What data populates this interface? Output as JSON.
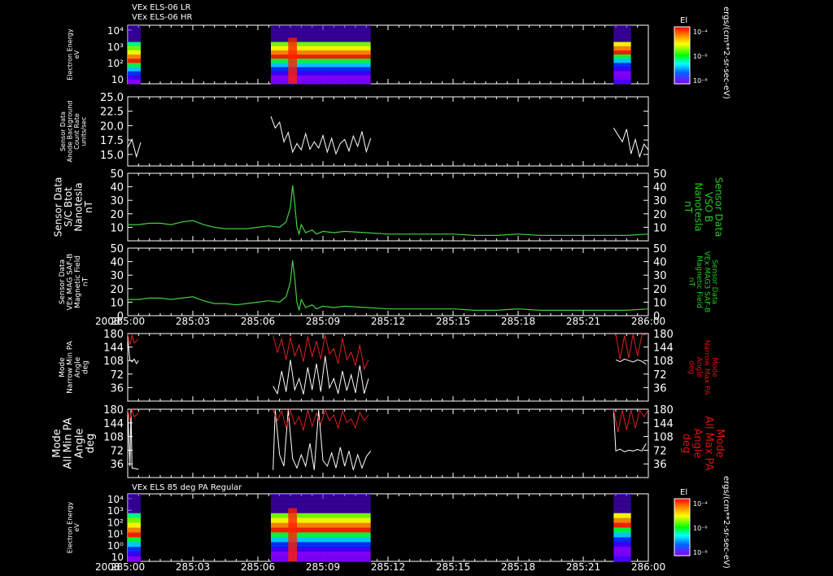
{
  "titles": {
    "top_line1": "VEx ELS-06 LR",
    "top_line2": "VEx ELS-06 HR",
    "bottom": "VEx ELS 85 deg PA Regular"
  },
  "year_label": "2008",
  "time_ticks": [
    "285:00",
    "285:03",
    "285:06",
    "285:09",
    "285:12",
    "285:15",
    "285:18",
    "285:21",
    "286:00"
  ],
  "colorbar": {
    "label": "El",
    "units": "ergs/(cm**2-sr-sec-eV)",
    "tick_labels": [
      "10⁻⁴",
      "10⁻⁶",
      "10⁻⁸"
    ]
  },
  "colors": {
    "trace": "#40d040",
    "min_pa": "#ffffff",
    "max_pa": "#e02020",
    "right_label": "#22c822",
    "right_label_red": "#dd1111"
  },
  "chart_data": [
    {
      "type": "heatmap",
      "panel": "electron-energy-top",
      "ylabel": [
        "Electron Energy",
        "eV"
      ],
      "y_tick_labels": [
        "10⁴",
        "10³",
        "10²",
        "10"
      ],
      "y_scale": "log",
      "data_intervals": [
        [
          "285:00.0",
          "285:00.6"
        ],
        [
          "285:06.6",
          "285:11.2"
        ],
        [
          "285:22.4",
          "285:23.2"
        ]
      ]
    },
    {
      "type": "line",
      "panel": "background-count",
      "ylabel": [
        "Sensor Data",
        "Anode Background",
        "Count Rate",
        "units/sec"
      ],
      "ylim": [
        13,
        25
      ],
      "y_tick_labels": [
        "25.0",
        "22.5",
        "20.0",
        "17.5",
        "15.0"
      ],
      "series": [
        {
          "x_min": [
            0.0,
            0.2,
            0.4,
            0.6
          ],
          "y": [
            16.2,
            17.6,
            14.6,
            17.1
          ]
        },
        {
          "x_min": [
            6.6,
            6.8,
            7.0,
            7.2,
            7.4,
            7.6,
            7.8,
            8.0,
            8.2,
            8.4,
            8.6,
            8.8,
            9.0,
            9.2,
            9.4,
            9.6,
            9.8,
            10.0,
            10.2,
            10.4,
            10.6,
            10.8,
            11.0,
            11.2
          ],
          "y": [
            21.6,
            19.6,
            20.6,
            17.2,
            18.8,
            15.4,
            16.9,
            15.8,
            18.6,
            15.9,
            17.2,
            16.1,
            18.3,
            15.4,
            17.8,
            15.1,
            16.9,
            17.6,
            15.6,
            18.2,
            16.4,
            19.0,
            15.5,
            17.8
          ]
        },
        {
          "x_min": [
            22.4,
            22.6,
            22.8,
            23.0,
            23.2,
            23.4,
            23.6,
            23.8,
            24.0
          ],
          "y": [
            19.6,
            18.4,
            17.2,
            19.4,
            15.1,
            17.6,
            14.6,
            16.8,
            15.8
          ]
        }
      ]
    },
    {
      "type": "line",
      "panel": "sc-btot",
      "ylabel": [
        "Sensor Data",
        "S/C Btot",
        "Nanotesla",
        "nT"
      ],
      "ylabel_right": [
        "Sensor Data",
        "VSO B",
        "Nanotesla",
        "nT"
      ],
      "ylim": [
        0,
        50
      ],
      "y_tick_labels": [
        "50",
        "40",
        "30",
        "20",
        "10"
      ],
      "x_min": [
        0,
        0.5,
        1,
        1.5,
        2,
        2.5,
        3,
        3.5,
        4,
        4.5,
        5,
        5.5,
        6,
        6.5,
        7,
        7.3,
        7.5,
        7.6,
        7.7,
        7.8,
        7.9,
        8.0,
        8.2,
        8.5,
        8.7,
        9,
        9.5,
        10,
        11,
        12,
        13,
        14,
        15,
        16,
        17,
        18,
        19,
        20,
        21,
        22,
        23,
        24
      ],
      "y": [
        12,
        12,
        13,
        13,
        12,
        14,
        15,
        12,
        10,
        9,
        9,
        9,
        10,
        11,
        10,
        14,
        25,
        41,
        28,
        10,
        5,
        12,
        6,
        8,
        5,
        7,
        6,
        7,
        6,
        5,
        5,
        5,
        5,
        4,
        4,
        5,
        4,
        4,
        4,
        4,
        4,
        5
      ]
    },
    {
      "type": "line",
      "panel": "mag-field",
      "ylabel": [
        "Sensor Data",
        "VEx MAG SAF-B",
        "Magnetic Field",
        "nT"
      ],
      "ylabel_right": [
        "Sensor Data",
        "VEx MAG3 SAF-B",
        "Magnetic Field",
        "nT"
      ],
      "ylim": [
        0,
        50
      ],
      "y_tick_labels": [
        "50",
        "40",
        "30",
        "20",
        "10",
        "0"
      ],
      "x_min": [
        0,
        0.5,
        1,
        1.5,
        2,
        2.5,
        3,
        3.5,
        4,
        4.5,
        5,
        5.5,
        6,
        6.5,
        7,
        7.3,
        7.5,
        7.6,
        7.7,
        7.8,
        7.9,
        8.0,
        8.2,
        8.5,
        8.7,
        9,
        9.5,
        10,
        11,
        12,
        13,
        14,
        15,
        16,
        17,
        18,
        19,
        20,
        21,
        22,
        23,
        24
      ],
      "y": [
        12,
        12,
        13,
        13,
        12,
        13,
        14,
        11,
        9,
        9,
        8,
        9,
        10,
        11,
        10,
        14,
        25,
        41,
        28,
        10,
        4,
        12,
        6,
        8,
        5,
        7,
        6,
        7,
        6,
        5,
        5,
        5,
        5,
        4,
        4,
        5,
        4,
        4,
        4,
        4,
        4,
        5
      ]
    },
    {
      "type": "line",
      "panel": "narrow-pa",
      "ylabel": [
        "Mode",
        "Narrow Min PA",
        "Angle",
        "deg"
      ],
      "ylabel_right": [
        "Mode",
        "Narrow Max PA",
        "Angle",
        "deg"
      ],
      "ylim": [
        0,
        180
      ],
      "y_tick_labels": [
        "180",
        "144",
        "108",
        "72",
        "36"
      ],
      "series": [
        {
          "name_ref": "min",
          "segments": [
            {
              "x_min": [
                0.0,
                0.1,
                0.2,
                0.3,
                0.4,
                0.5
              ],
              "y": [
                165,
                110,
                105,
                112,
                100,
                108
              ]
            },
            {
              "x_min": [
                6.7,
                6.9,
                7.1,
                7.3,
                7.5,
                7.7,
                7.9,
                8.1,
                8.3,
                8.5,
                8.7,
                8.9,
                9.1,
                9.3,
                9.5,
                9.7,
                9.9,
                10.1,
                10.3,
                10.5,
                10.7,
                10.9,
                11.1
              ],
              "y": [
                40,
                20,
                80,
                25,
                110,
                30,
                60,
                18,
                90,
                30,
                100,
                25,
                120,
                35,
                60,
                20,
                80,
                28,
                70,
                22,
                95,
                20,
                60
              ]
            },
            {
              "x_min": [
                22.5,
                22.7,
                22.9,
                23.1,
                23.3,
                23.5,
                23.7,
                23.9
              ],
              "y": [
                110,
                105,
                112,
                108,
                104,
                110,
                106,
                98
              ]
            }
          ]
        },
        {
          "name_ref": "max",
          "segments": [
            {
              "x_min": [
                0.0,
                0.1,
                0.2,
                0.3,
                0.4,
                0.5
              ],
              "y": [
                178,
                150,
                175,
                155,
                160,
                165
              ]
            },
            {
              "x_min": [
                6.7,
                6.9,
                7.1,
                7.3,
                7.5,
                7.7,
                7.9,
                8.1,
                8.3,
                8.5,
                8.7,
                8.9,
                9.1,
                9.3,
                9.5,
                9.7,
                9.9,
                10.1,
                10.3,
                10.5,
                10.7,
                10.9,
                11.1
              ],
              "y": [
                175,
                130,
                165,
                110,
                170,
                120,
                150,
                105,
                172,
                118,
                160,
                112,
                176,
                125,
                140,
                100,
                168,
                110,
                130,
                95,
                150,
                85,
                110
              ]
            },
            {
              "x_min": [
                22.5,
                22.7,
                22.9,
                23.1,
                23.3,
                23.5,
                23.7,
                23.9
              ],
              "y": [
                178,
                112,
                175,
                115,
                178,
                120,
                176,
                178
              ]
            }
          ]
        }
      ]
    },
    {
      "type": "line",
      "panel": "all-pa",
      "ylabel": [
        "Mode",
        "All Min PA",
        "Angle",
        "deg"
      ],
      "ylabel_right": [
        "Mode",
        "All Max PA",
        "Angle",
        "deg"
      ],
      "ylim": [
        0,
        180
      ],
      "y_tick_labels": [
        "180",
        "144",
        "108",
        "72",
        "36"
      ],
      "series": [
        {
          "name_ref": "min",
          "segments": [
            {
              "x_min": [
                0.0,
                0.1,
                0.15,
                0.2,
                0.5
              ],
              "y": [
                178,
                30,
                178,
                25,
                22
              ]
            },
            {
              "x_min": [
                6.7,
                6.8,
                7.0,
                7.2,
                7.4,
                7.6,
                7.8,
                8.0,
                8.2,
                8.4,
                8.6,
                8.8,
                9.0,
                9.2,
                9.4,
                9.6,
                9.8,
                10.0,
                10.2,
                10.4,
                10.6,
                10.8,
                11.0,
                11.2
              ],
              "y": [
                20,
                178,
                60,
                30,
                178,
                50,
                25,
                60,
                30,
                90,
                20,
                178,
                45,
                30,
                65,
                25,
                80,
                30,
                70,
                20,
                60,
                25,
                55,
                70
              ]
            },
            {
              "x_min": [
                22.4,
                22.5,
                22.7,
                22.9,
                23.1,
                23.3,
                23.5,
                23.7,
                23.9
              ],
              "y": [
                178,
                70,
                75,
                68,
                72,
                70,
                74,
                70,
                90
              ]
            }
          ]
        },
        {
          "name_ref": "max",
          "segments": [
            {
              "x_min": [
                0.0,
                0.1,
                0.2,
                0.3,
                0.5
              ],
              "y": [
                178,
                150,
                178,
                160,
                170
              ]
            },
            {
              "x_min": [
                6.7,
                6.9,
                7.1,
                7.3,
                7.5,
                7.7,
                7.9,
                8.1,
                8.3,
                8.5,
                8.7,
                8.9,
                9.1,
                9.3,
                9.5,
                9.7,
                9.9,
                10.1,
                10.3,
                10.5,
                10.7,
                10.9,
                11.1
              ],
              "y": [
                178,
                150,
                175,
                130,
                178,
                140,
                160,
                125,
                178,
                135,
                170,
                140,
                178,
                150,
                165,
                130,
                175,
                145,
                155,
                130,
                172,
                150,
                165
              ]
            },
            {
              "x_min": [
                22.4,
                22.6,
                22.8,
                23.0,
                23.2,
                23.4,
                23.6,
                23.8,
                24.0
              ],
              "y": [
                178,
                120,
                178,
                125,
                178,
                130,
                178,
                160,
                178
              ]
            }
          ]
        }
      ]
    },
    {
      "type": "heatmap",
      "panel": "electron-energy-85pa",
      "ylabel": [
        "Electron Energy",
        "eV"
      ],
      "y_tick_labels": [
        "10⁴",
        "10³",
        "10²",
        "10¹",
        "10⁰",
        "10"
      ],
      "y_scale": "log",
      "data_intervals": [
        [
          "285:00.0",
          "285:00.6"
        ],
        [
          "285:06.6",
          "285:11.2"
        ],
        [
          "285:22.4",
          "285:23.2"
        ]
      ]
    }
  ]
}
